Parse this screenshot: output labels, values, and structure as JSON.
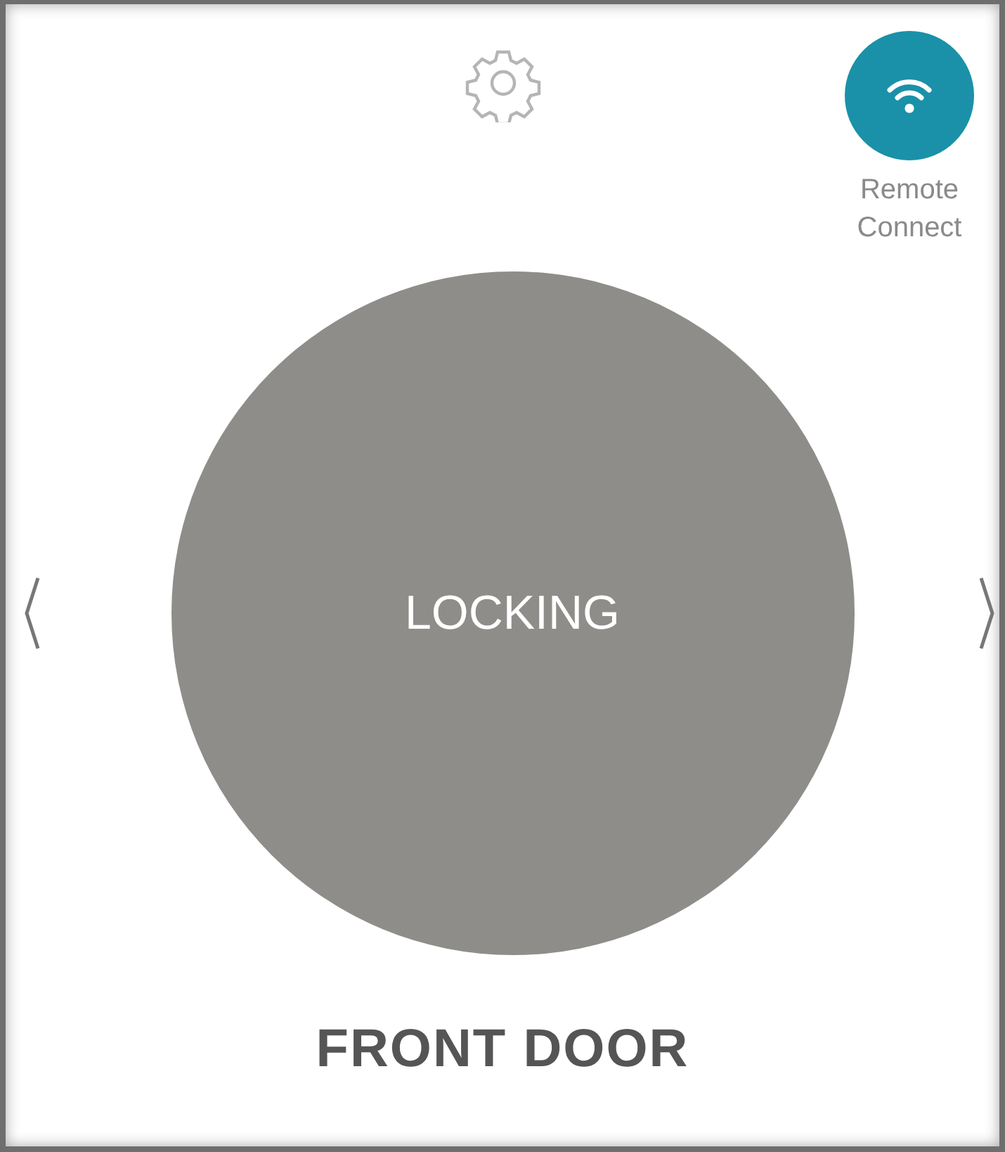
{
  "remote_connect": {
    "label": "Remote Connect"
  },
  "lock_button": {
    "status": "LOCKING"
  },
  "door": {
    "name": "FRONT DOOR"
  }
}
